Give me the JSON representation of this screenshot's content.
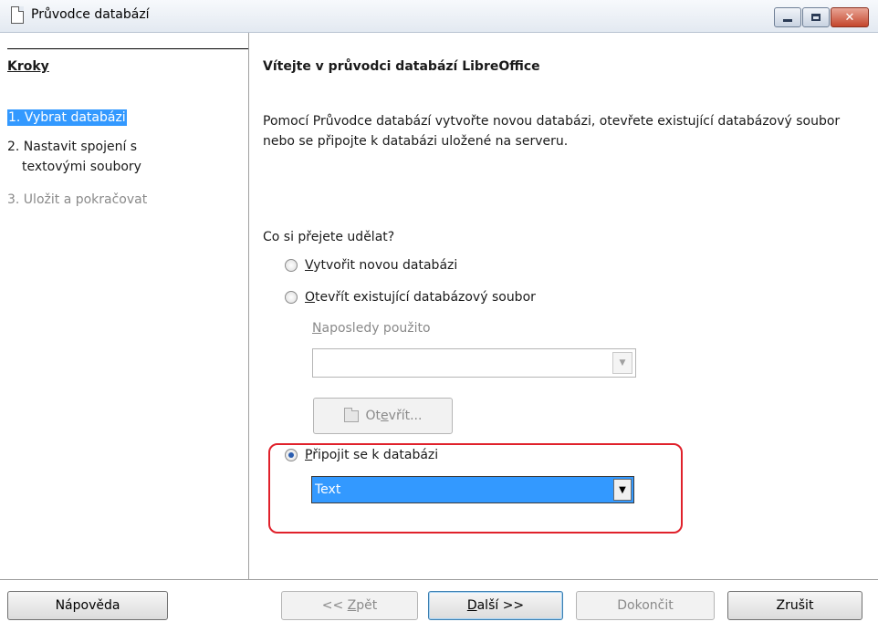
{
  "window": {
    "title": "Průvodce databází"
  },
  "steps": {
    "header": "Kroky",
    "items": [
      {
        "label": "1. Vybrat databázi",
        "state": "active"
      },
      {
        "label": "2. Nastavit spojení s",
        "label_line2": "textovými soubory",
        "state": "normal"
      },
      {
        "label": "3. Uložit a pokračovat",
        "state": "disabled"
      }
    ]
  },
  "main": {
    "heading": "Vítejte v průvodci databází LibreOffice",
    "description": "Pomocí Průvodce databází vytvořte novou databázi, otevřete existující databázový soubor nebo se připojte k databázi uložené na serveru.",
    "question": "Co si přejete udělat?",
    "options": [
      {
        "prefix": "",
        "mnemonic": "V",
        "rest": "ytvořit novou databázi",
        "checked": false
      },
      {
        "prefix": "",
        "mnemonic": "O",
        "rest": "tevřít existující databázový soubor",
        "checked": false
      },
      {
        "prefix": "",
        "mnemonic": "P",
        "rest": "řipojit se k databázi",
        "checked": true
      }
    ],
    "recent_label_mnemonic": "N",
    "recent_label_rest": "aposledy použito",
    "recent_value": "",
    "open_button_pre": "Ot",
    "open_button_mnemonic": "e",
    "open_button_post": "vřít...",
    "connection_type": "Text"
  },
  "buttons": {
    "help": "Nápověda",
    "back_pre": "<< ",
    "back_mnemonic": "Z",
    "back_post": "pět",
    "next_mnemonic": "D",
    "next_post": "alší >>",
    "finish": "Dokončit",
    "cancel": "Zrušit"
  },
  "colors": {
    "selection": "#3399ff",
    "highlight_ring": "#e0212b"
  }
}
